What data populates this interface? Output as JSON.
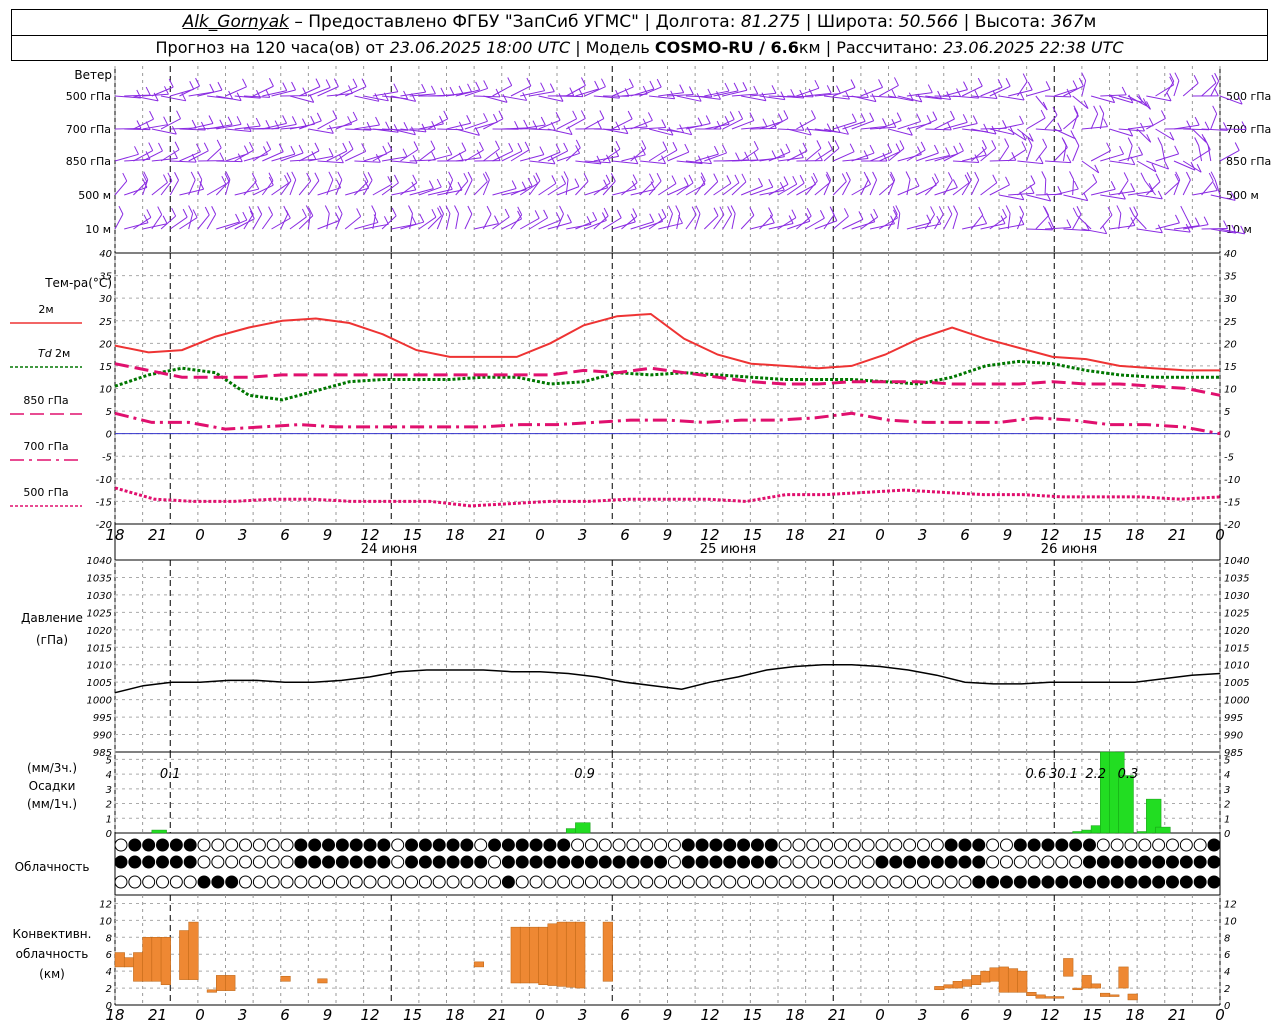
{
  "header": {
    "station": "Alk_Gornyak",
    "provider": "– Предоставлено ФГБУ \"ЗапСиб УГМС\"",
    "lon_label": "Долгота:",
    "lon": "81.275",
    "lat_label": "Широта:",
    "lat": "50.566",
    "alt_label": "Высота:",
    "alt": "367",
    "alt_unit": "м",
    "forecast_prefix": "Прогноз на 120 часа(ов) от",
    "forecast_start": "23.06.2025 18:00 UTC",
    "model_label": "Модель",
    "model": "COSMO-RU / 6.6",
    "model_unit": "км",
    "computed_label": "Рассчитано:",
    "computed": "23.06.2025 22:38 UTC"
  },
  "x_ticks": [
    "18",
    "21",
    "0",
    "3",
    "6",
    "9",
    "12",
    "15",
    "18",
    "21",
    "0",
    "3",
    "6",
    "9",
    "12",
    "15",
    "18",
    "21",
    "0",
    "3",
    "6",
    "9",
    "12",
    "15",
    "18",
    "21",
    "0"
  ],
  "day_labels": [
    "24 июня",
    "25 июня",
    "26 июня"
  ],
  "wind_panel": {
    "title": "Ветер",
    "levels": [
      "500 гПа",
      "700 гПа",
      "850 гПа",
      "500 м",
      "10 м"
    ]
  },
  "colors": {
    "wind": "#8a2be2",
    "t2m": "#ee3333",
    "td2m": "#007700",
    "t850": "#e0106e",
    "t700": "#e0106e",
    "t500": "#e0106e",
    "pressure": "#000000",
    "precip": "#22dd22",
    "convective": "#ee8833",
    "zero_line": "#3333cc"
  },
  "labels": {
    "temp_title": "Тем-ра(°С)",
    "t2m": "2м",
    "td_prefix": "Td",
    "td2m": "2м",
    "t850": "850 гПа",
    "t700": "700 гПа",
    "t500": "500 гПа",
    "pressure_title": "Давление",
    "pressure_unit": "(гПа)",
    "precip_unit3": "(мм/3ч.)",
    "precip_title": "Осадки",
    "precip_unit1": "(мм/1ч.)",
    "cloud_title": "Облачность",
    "conv_title1": "Конвективн.",
    "conv_title2": "облачность",
    "conv_unit": "(км)"
  },
  "chart_data": [
    {
      "type": "line",
      "title": "Тем-ра(°С)",
      "hours": [
        0,
        3,
        6,
        9,
        12,
        15,
        18,
        21,
        24,
        27,
        30,
        33,
        36,
        39,
        42,
        45,
        48,
        51,
        54,
        57,
        60,
        63,
        66,
        69,
        72,
        75,
        78,
        81,
        84,
        87,
        90,
        93,
        96,
        99,
        102,
        105,
        108,
        111,
        114,
        117,
        120
      ],
      "ylim": [
        -20,
        40
      ],
      "yticks": [
        -20,
        -15,
        -10,
        -5,
        0,
        5,
        10,
        15,
        20,
        25,
        30,
        35,
        40
      ],
      "series": [
        {
          "name": "2м",
          "style": "solid",
          "values": [
            19.5,
            18,
            18.5,
            21.5,
            23.5,
            25,
            25.5,
            24.5,
            22,
            18.5,
            17,
            17,
            17,
            20,
            24,
            26,
            26.5,
            21,
            17.5,
            15.5,
            15,
            14.5,
            15,
            17.5,
            21,
            23.5,
            21,
            19,
            17,
            16.5,
            15,
            14.5,
            14,
            14
          ]
        },
        {
          "name": "Td 2м",
          "style": "dotted",
          "values": [
            10.5,
            13,
            14.5,
            13.5,
            8.5,
            7.5,
            9.5,
            11.5,
            12,
            12,
            12,
            12.5,
            12.5,
            11,
            11.5,
            13.5,
            13,
            13.5,
            13,
            12.5,
            12,
            12,
            12,
            11.5,
            11,
            12.5,
            15,
            16,
            15.5,
            14,
            13,
            12.5,
            12.5,
            12.5
          ]
        },
        {
          "name": "850 гПа",
          "style": "dashed",
          "values": [
            15.5,
            14,
            12.5,
            12.5,
            12.5,
            13,
            13,
            13,
            13,
            13,
            13,
            13,
            13,
            13,
            14,
            13.5,
            14.5,
            13.5,
            12.5,
            11.5,
            11,
            11,
            11.5,
            11.5,
            11.5,
            11,
            11,
            11,
            11.5,
            11,
            11,
            10.5,
            10,
            8.5
          ]
        },
        {
          "name": "700 гПа",
          "style": "dashdot",
          "values": [
            4.5,
            2.5,
            2.5,
            1,
            1.5,
            2,
            1.5,
            1.5,
            1.5,
            1.5,
            1.5,
            2,
            2,
            2.5,
            3,
            3,
            2.5,
            3,
            3,
            3.5,
            4.5,
            3,
            2.5,
            2.5,
            2.5,
            3.5,
            3,
            2,
            2,
            1.5,
            0
          ]
        },
        {
          "name": "500 гПа",
          "style": "dotted",
          "values": [
            -12,
            -14.5,
            -15,
            -15,
            -14.5,
            -14.5,
            -15,
            -15,
            -15,
            -16,
            -15.5,
            -15,
            -15,
            -14.5,
            -14.5,
            -14.5,
            -15,
            -13.5,
            -13.5,
            -13,
            -12.5,
            -13,
            -13.5,
            -13.5,
            -14,
            -14,
            -14,
            -14.5,
            -14
          ]
        }
      ]
    },
    {
      "type": "line",
      "title": "Давление",
      "ylabel": "(гПа)",
      "ylim": [
        985,
        1040
      ],
      "yticks": [
        985,
        990,
        995,
        1000,
        1005,
        1010,
        1015,
        1020,
        1025,
        1030,
        1035,
        1040
      ],
      "series": [
        {
          "name": "Давление",
          "values": [
            1002,
            1004,
            1005,
            1005,
            1005.5,
            1005.5,
            1005,
            1005,
            1005.5,
            1006.5,
            1008,
            1008.5,
            1008.5,
            1008.5,
            1008,
            1008,
            1007.5,
            1006.5,
            1005,
            1004,
            1003,
            1005,
            1006.5,
            1008.5,
            1009.5,
            1010,
            1010,
            1009.5,
            1008.5,
            1007,
            1005,
            1004.5,
            1004.5,
            1005,
            1005,
            1005,
            1005,
            1006,
            1007,
            1007.5
          ]
        }
      ]
    },
    {
      "type": "bar",
      "title": "Осадки",
      "ylim": [
        0,
        5.5
      ],
      "yticks": [
        0,
        1,
        2,
        3,
        4,
        5
      ],
      "bars": [
        {
          "hour": 4,
          "value": 0.2
        },
        {
          "hour": 49,
          "value": 0.3
        },
        {
          "hour": 50,
          "value": 0.7
        },
        {
          "hour": 104,
          "value": 0.1
        },
        {
          "hour": 105,
          "value": 0.2
        },
        {
          "hour": 106,
          "value": 0.5
        },
        {
          "hour": 107,
          "value": 5.5
        },
        {
          "hour": 108,
          "value": 5.5
        },
        {
          "hour": 109,
          "value": 3.9
        },
        {
          "hour": 111,
          "value": 0.1
        },
        {
          "hour": 112,
          "value": 2.3
        },
        {
          "hour": 113,
          "value": 0.4
        }
      ],
      "totals": [
        {
          "hour": 6,
          "label": "0.1"
        },
        {
          "hour": 51,
          "label": "0.9"
        },
        {
          "hour": 100,
          "label": "0.6"
        },
        {
          "hour": 103,
          "label": "30.1"
        },
        {
          "hour": 106.5,
          "label": "2.2"
        },
        {
          "hour": 110,
          "label": "0.3"
        }
      ]
    },
    {
      "type": "bar",
      "title": "Конвективн. облачность (км)",
      "ylim": [
        0,
        13
      ],
      "yticks": [
        0,
        2,
        4,
        6,
        8,
        10,
        12
      ],
      "bars": [
        {
          "hour": 0,
          "bottom": 4.5,
          "top": 6.2
        },
        {
          "hour": 1,
          "bottom": 4.5,
          "top": 5.6
        },
        {
          "hour": 2,
          "bottom": 2.8,
          "top": 6.2
        },
        {
          "hour": 3,
          "bottom": 2.8,
          "top": 8.0
        },
        {
          "hour": 4,
          "bottom": 2.8,
          "top": 8.0
        },
        {
          "hour": 5,
          "bottom": 2.4,
          "top": 8.0
        },
        {
          "hour": 7,
          "bottom": 3.0,
          "top": 8.8
        },
        {
          "hour": 8,
          "bottom": 3.0,
          "top": 9.8
        },
        {
          "hour": 10,
          "bottom": 1.5,
          "top": 1.8
        },
        {
          "hour": 11,
          "bottom": 1.7,
          "top": 3.5
        },
        {
          "hour": 12,
          "bottom": 1.7,
          "top": 3.5
        },
        {
          "hour": 18,
          "bottom": 2.8,
          "top": 3.4
        },
        {
          "hour": 22,
          "bottom": 2.6,
          "top": 3.1
        },
        {
          "hour": 39,
          "bottom": 4.5,
          "top": 5.1
        },
        {
          "hour": 43,
          "bottom": 2.6,
          "top": 9.2
        },
        {
          "hour": 44,
          "bottom": 2.6,
          "top": 9.2
        },
        {
          "hour": 45,
          "bottom": 2.6,
          "top": 9.2
        },
        {
          "hour": 46,
          "bottom": 2.4,
          "top": 9.2
        },
        {
          "hour": 47,
          "bottom": 2.3,
          "top": 9.6
        },
        {
          "hour": 48,
          "bottom": 2.2,
          "top": 9.8
        },
        {
          "hour": 49,
          "bottom": 2.1,
          "top": 9.8
        },
        {
          "hour": 50,
          "bottom": 2.0,
          "top": 9.8
        },
        {
          "hour": 53,
          "bottom": 2.8,
          "top": 9.8
        },
        {
          "hour": 89,
          "bottom": 1.8,
          "top": 2.2
        },
        {
          "hour": 90,
          "bottom": 2.0,
          "top": 2.4
        },
        {
          "hour": 91,
          "bottom": 2.0,
          "top": 2.8
        },
        {
          "hour": 92,
          "bottom": 2.2,
          "top": 3.0
        },
        {
          "hour": 93,
          "bottom": 2.4,
          "top": 3.5
        },
        {
          "hour": 94,
          "bottom": 2.7,
          "top": 4.0
        },
        {
          "hour": 95,
          "bottom": 2.8,
          "top": 4.4
        },
        {
          "hour": 96,
          "bottom": 1.5,
          "top": 4.5
        },
        {
          "hour": 97,
          "bottom": 1.5,
          "top": 4.3
        },
        {
          "hour": 98,
          "bottom": 1.5,
          "top": 4.0
        },
        {
          "hour": 99,
          "bottom": 1.1,
          "top": 1.5
        },
        {
          "hour": 100,
          "bottom": 0.8,
          "top": 1.2
        },
        {
          "hour": 101,
          "bottom": 0.8,
          "top": 1.0
        },
        {
          "hour": 102,
          "bottom": 0.8,
          "top": 1.0
        },
        {
          "hour": 103,
          "bottom": 3.4,
          "top": 5.5
        },
        {
          "hour": 104,
          "bottom": 1.8,
          "top": 2.0
        },
        {
          "hour": 105,
          "bottom": 2.0,
          "top": 3.5
        },
        {
          "hour": 106,
          "bottom": 2.0,
          "top": 2.5
        },
        {
          "hour": 107,
          "bottom": 1.0,
          "top": 1.4
        },
        {
          "hour": 108,
          "bottom": 1.0,
          "top": 1.2
        },
        {
          "hour": 109,
          "bottom": 2.0,
          "top": 4.5
        },
        {
          "hour": 110,
          "bottom": 0.6,
          "top": 1.3
        }
      ]
    }
  ],
  "cloud_rows": [
    "0111111111000000000000111111111111001111111111011111111111000000000000001111111111110000000000000000000000111110101111111111110000000000000111",
    "1111111111000000000000111111111111001111111111011111111111111111111100111111111111000000000000111111111111110000000000000111111111111111111",
    "000000000011110000000000000000000000000000000011000000000000000000000000000000000000000000000000000000001111111111111111111111111111111"
  ]
}
